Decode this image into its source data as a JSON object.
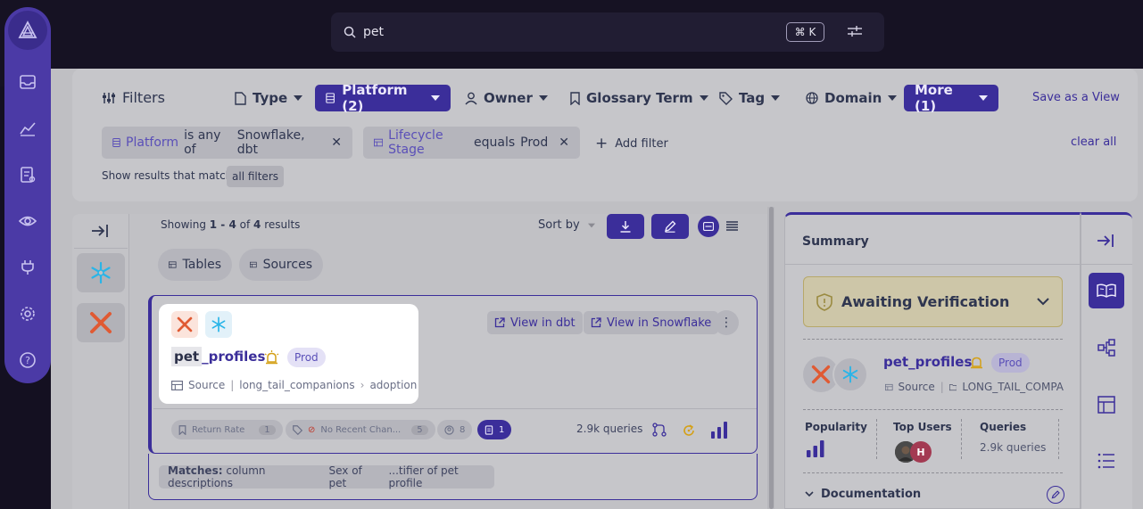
{
  "search": {
    "value": "pet",
    "shortcut": "⌘ K"
  },
  "filters": {
    "title": "Filters",
    "items": [
      {
        "label": "Type"
      },
      {
        "label": "Platform (2)",
        "selected": true
      },
      {
        "label": "Owner"
      },
      {
        "label": "Glossary Term"
      },
      {
        "label": "Tag"
      },
      {
        "label": "Domain"
      },
      {
        "label": "More (1)",
        "selected": true
      }
    ],
    "save_view": "Save as a View",
    "active": [
      {
        "field": "Platform",
        "op": "is any of",
        "value": "Snowflake, dbt"
      },
      {
        "field": "Lifecycle Stage",
        "op": "equals",
        "value": "Prod"
      }
    ],
    "add_filter": "Add filter",
    "clear_all": "clear all",
    "match_prefix": "Show results that match",
    "match_mode": "all filters"
  },
  "results": {
    "showing_prefix": "Showing",
    "range": "1 - 4",
    "of": "of",
    "total": "4",
    "suffix": "results",
    "sort_label": "Sort by",
    "tabs": [
      "Tables",
      "Sources"
    ]
  },
  "card": {
    "name_highlight": "pet",
    "name_rest": "_profiles",
    "badge": "Prod",
    "subtype": "Source",
    "path1": "long_tail_companions",
    "path2": "adoption",
    "view_dbt": "View in dbt",
    "view_snowflake": "View in Snowflake",
    "chip1": "Return Rate",
    "chip1_count": "1",
    "chip2": "No Recent Chan...",
    "chip2_count": "5",
    "chip3_count": "8",
    "chip4_count": "1",
    "queries": "2.9k queries",
    "matches_label": "Matches:",
    "match1": "column descriptions",
    "match2": "Sex of pet",
    "match3": "...tifier of pet profile"
  },
  "summary": {
    "title": "Summary",
    "verification": "Awaiting Verification",
    "name": "pet_profiles",
    "badge": "Prod",
    "subtype": "Source",
    "container": "LONG_TAIL_COMPA",
    "popularity_label": "Popularity",
    "top_users_label": "Top Users",
    "queries_label": "Queries",
    "queries_value": "2.9k queries",
    "user_initial": "H",
    "documentation": "Documentation"
  },
  "colors": {
    "accent": "#3b2e9a",
    "dbt": "#e05a33",
    "snowflake": "#29b5e8"
  }
}
